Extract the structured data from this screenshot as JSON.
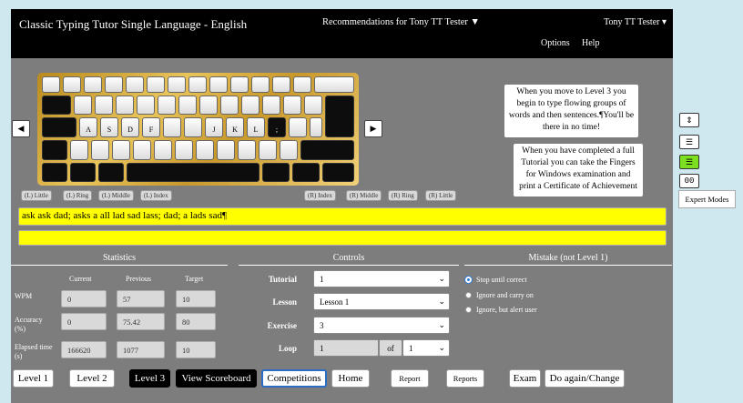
{
  "header": {
    "title": "Classic Typing Tutor Single Language - English",
    "recommendations": "Recommendations for Tony TT Tester ▼",
    "user": "Tony TT Tester ▾",
    "menu": [
      "Options",
      "Help"
    ]
  },
  "keyboard": {
    "home_labels": [
      "A",
      "S",
      "D",
      "F",
      "",
      "J",
      "K",
      "L",
      ";"
    ]
  },
  "fingers": {
    "left": [
      "(L) Little",
      "(L) Ring",
      "(L) Middle",
      "(L) Index"
    ],
    "right": [
      "(R) Index",
      "(R) Middle",
      "(R) Ring",
      "(R) Little"
    ]
  },
  "tips": [
    "When you move to Level 3 you begin to type flowing groups of words and then sentences.¶You'll be there in no time!",
    "When you have completed a full Tutorial you can take the Fingers for Windows examination and print a Certificate of Achievement"
  ],
  "typing": {
    "target": "ask ask dad; asks a all lad sad lass; dad; a lads sad¶",
    "input": ""
  },
  "statistics": {
    "heading": "Statistics",
    "columns": [
      "Current",
      "Previous",
      "Target"
    ],
    "rows": [
      {
        "label": "WPM",
        "current": "0",
        "previous": "57",
        "target": "10"
      },
      {
        "label": "Accuracy (%)",
        "current": "0",
        "previous": "75.42",
        "target": "80"
      },
      {
        "label": "Elapsed time (s)",
        "current": "166620",
        "previous": "1077",
        "target": "10"
      }
    ]
  },
  "controls": {
    "heading": "Controls",
    "tutorial_label": "Tutorial",
    "tutorial_value": "1",
    "lesson_label": "Lesson",
    "lesson_value": "Lesson 1",
    "exercise_label": "Exercise",
    "exercise_value": "3",
    "loop_label": "Loop",
    "loop_value": "1",
    "loop_of": "of",
    "loop_total": "1"
  },
  "mistake": {
    "heading": "Mistake (not Level 1)",
    "options": [
      "Stop until correct",
      "Ignore and carry on",
      "Ignore, but alert user"
    ],
    "selected": 0
  },
  "buttons": [
    "Level 1",
    "Level 2",
    "Level 3",
    "View Scoreboard",
    "Competitions",
    "Home",
    "Report",
    "Reports",
    "Exam",
    "Do again/Change"
  ],
  "side": {
    "expert_modes": "Expert Modes",
    "counter": "00"
  },
  "colors": {
    "header_bg": "#000000",
    "panel_bg": "#7d7d7d",
    "typing_bg": "#ffff00",
    "page_bg": "#cfe8f0",
    "active_mode": "#7ce021"
  }
}
